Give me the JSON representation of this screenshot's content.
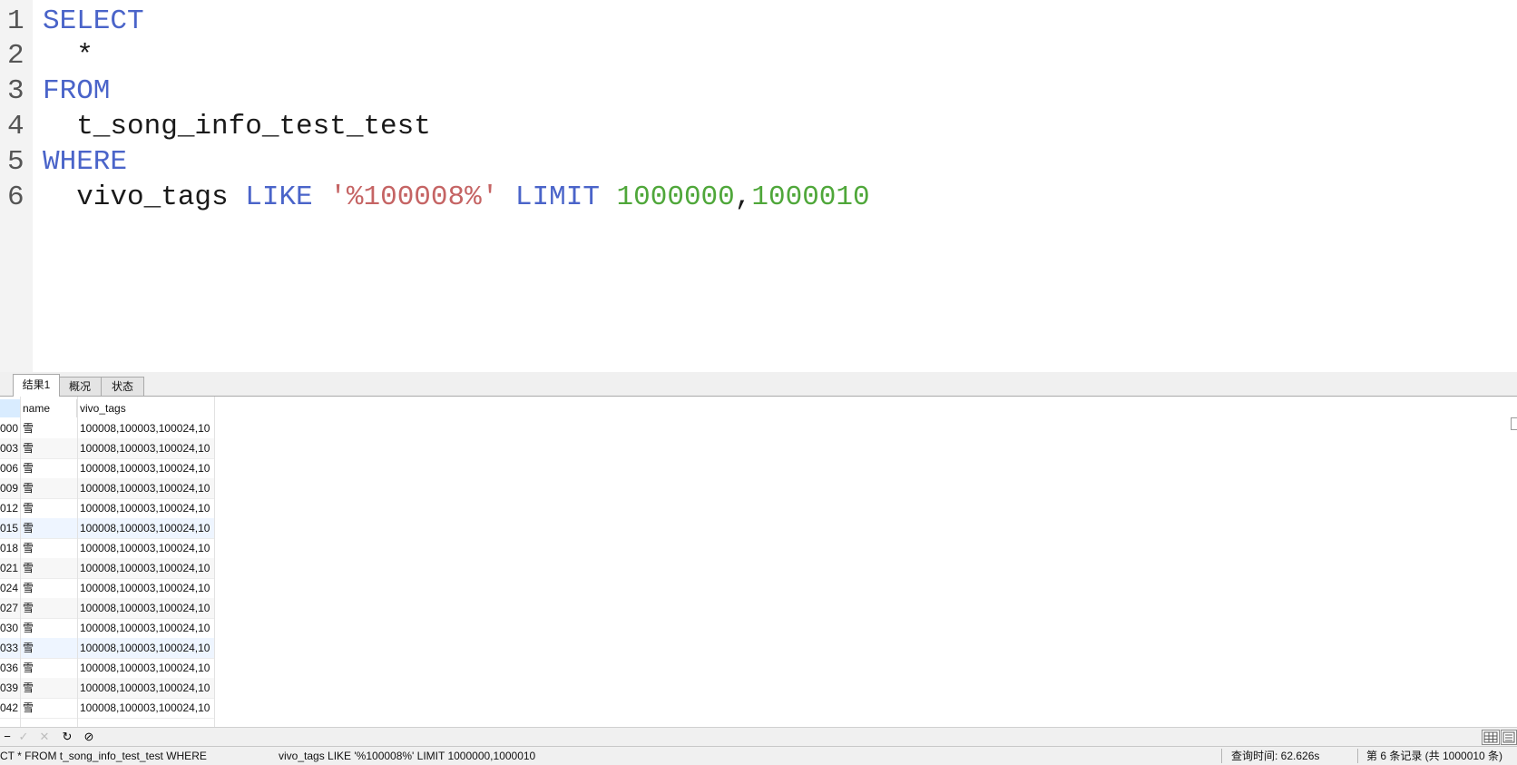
{
  "editor": {
    "lines": [
      {
        "num": "1",
        "tokens": [
          {
            "t": "SELECT",
            "k": "kw"
          }
        ]
      },
      {
        "num": "2",
        "tokens": [
          {
            "t": "  *",
            "k": "plain"
          }
        ]
      },
      {
        "num": "3",
        "tokens": [
          {
            "t": "FROM",
            "k": "kw"
          }
        ]
      },
      {
        "num": "4",
        "tokens": [
          {
            "t": "  t_song_info_test_test",
            "k": "plain"
          }
        ]
      },
      {
        "num": "5",
        "tokens": [
          {
            "t": "WHERE",
            "k": "kw"
          }
        ]
      },
      {
        "num": "6",
        "tokens": [
          {
            "t": "  vivo_tags ",
            "k": "plain"
          },
          {
            "t": "LIKE",
            "k": "kw"
          },
          {
            "t": " ",
            "k": "plain"
          },
          {
            "t": "'%100008%'",
            "k": "str"
          },
          {
            "t": " ",
            "k": "plain"
          },
          {
            "t": "LIMIT",
            "k": "kw"
          },
          {
            "t": " ",
            "k": "plain"
          },
          {
            "t": "1000000",
            "k": "num"
          },
          {
            "t": ",",
            "k": "plain"
          },
          {
            "t": "1000010",
            "k": "num"
          }
        ]
      }
    ]
  },
  "tabs": [
    {
      "label": "结果1",
      "active": true
    },
    {
      "label": "概况",
      "active": false
    },
    {
      "label": "状态",
      "active": false
    }
  ],
  "grid": {
    "columns": [
      "name",
      "vivo_tags"
    ],
    "rows": [
      {
        "id": "000",
        "name": "雪",
        "tags": "100008,100003,100024,10"
      },
      {
        "id": "003",
        "name": "雪",
        "tags": "100008,100003,100024,10"
      },
      {
        "id": "006",
        "name": "雪",
        "tags": "100008,100003,100024,10"
      },
      {
        "id": "009",
        "name": "雪",
        "tags": "100008,100003,100024,10"
      },
      {
        "id": "012",
        "name": "雪",
        "tags": "100008,100003,100024,10"
      },
      {
        "id": "015",
        "name": "雪",
        "tags": "100008,100003,100024,10"
      },
      {
        "id": "018",
        "name": "雪",
        "tags": "100008,100003,100024,10"
      },
      {
        "id": "021",
        "name": "雪",
        "tags": "100008,100003,100024,10"
      },
      {
        "id": "024",
        "name": "雪",
        "tags": "100008,100003,100024,10"
      },
      {
        "id": "027",
        "name": "雪",
        "tags": "100008,100003,100024,10"
      },
      {
        "id": "030",
        "name": "雪",
        "tags": "100008,100003,100024,10"
      },
      {
        "id": "033",
        "name": "雪",
        "tags": "100008,100003,100024,10"
      },
      {
        "id": "036",
        "name": "雪",
        "tags": "100008,100003,100024,10"
      },
      {
        "id": "039",
        "name": "雪",
        "tags": "100008,100003,100024,10"
      },
      {
        "id": "042",
        "name": "雪",
        "tags": "100008,100003,100024,10"
      }
    ]
  },
  "toolbar": {
    "buttons": [
      {
        "name": "delete-record-button",
        "glyph": "−",
        "enabled": true
      },
      {
        "name": "apply-changes-button",
        "glyph": "✓",
        "enabled": false
      },
      {
        "name": "discard-changes-button",
        "glyph": "✕",
        "enabled": false
      },
      {
        "name": "refresh-button",
        "glyph": "↻",
        "enabled": true
      },
      {
        "name": "stop-button",
        "glyph": "⊘",
        "enabled": true
      }
    ]
  },
  "status": {
    "query_text_1": "CT   * FROM   t_song_info_test_test WHERE",
    "query_text_2": "vivo_tags LIKE '%100008%' LIMIT 1000000,1000010",
    "query_time": "查询时间: 62.626s",
    "record_info": "第 6 条记录 (共 1000010 条)"
  },
  "colors": {
    "keyword": "#4a64c9",
    "string": "#c56464",
    "number": "#4fa73a"
  }
}
